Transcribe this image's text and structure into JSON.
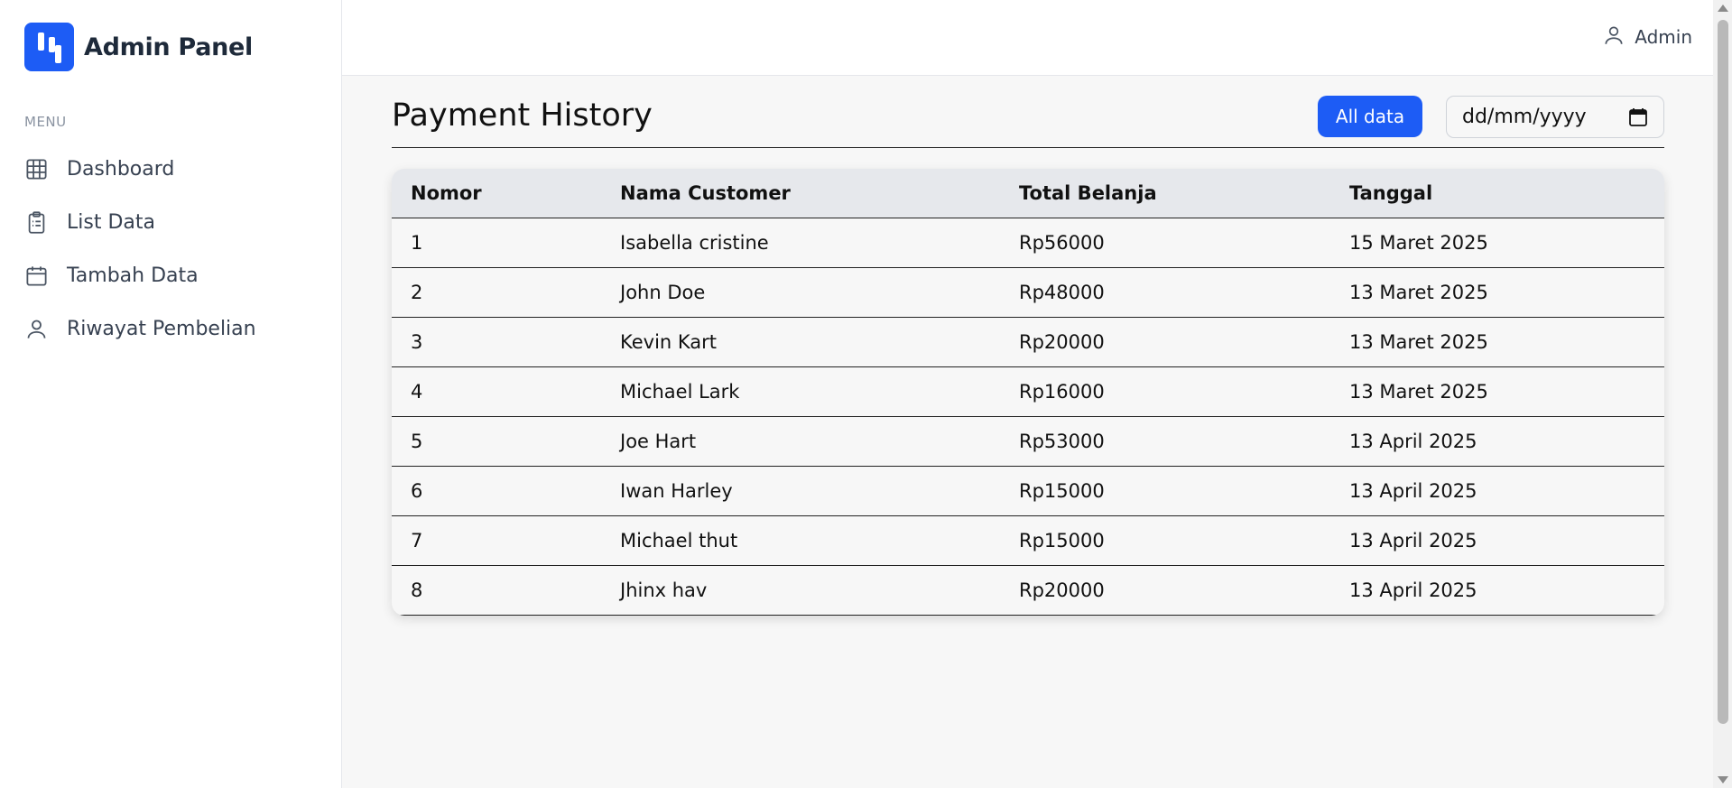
{
  "brand": {
    "title": "Admin Panel"
  },
  "sidebar": {
    "menu_label": "MENU",
    "items": [
      {
        "label": "Dashboard",
        "icon": "grid-icon"
      },
      {
        "label": "List Data",
        "icon": "clipboard-icon"
      },
      {
        "label": "Tambah Data",
        "icon": "calendar-icon"
      },
      {
        "label": "Riwayat Pembelian",
        "icon": "user-icon"
      }
    ]
  },
  "topbar": {
    "user_name": "Admin"
  },
  "main": {
    "title": "Payment History",
    "all_data_label": "All data",
    "date_placeholder": "dd/mm/yyyy"
  },
  "table": {
    "headers": [
      "Nomor",
      "Nama Customer",
      "Total Belanja",
      "Tanggal"
    ],
    "rows": [
      [
        "1",
        "Isabella cristine",
        "Rp56000",
        "15 Maret 2025"
      ],
      [
        "2",
        "John Doe",
        "Rp48000",
        "13 Maret 2025"
      ],
      [
        "3",
        "Kevin Kart",
        "Rp20000",
        "13 Maret 2025"
      ],
      [
        "4",
        "Michael Lark",
        "Rp16000",
        "13 Maret 2025"
      ],
      [
        "5",
        "Joe Hart",
        "Rp53000",
        "13 April 2025"
      ],
      [
        "6",
        "Iwan Harley",
        "Rp15000",
        "13 April 2025"
      ],
      [
        "7",
        "Michael thut",
        "Rp15000",
        "13 April 2025"
      ],
      [
        "8",
        "Jhinx hav",
        "Rp20000",
        "13 April 2025"
      ]
    ]
  },
  "colors": {
    "accent": "#1d5cf5",
    "sidebar_text": "#374151"
  }
}
